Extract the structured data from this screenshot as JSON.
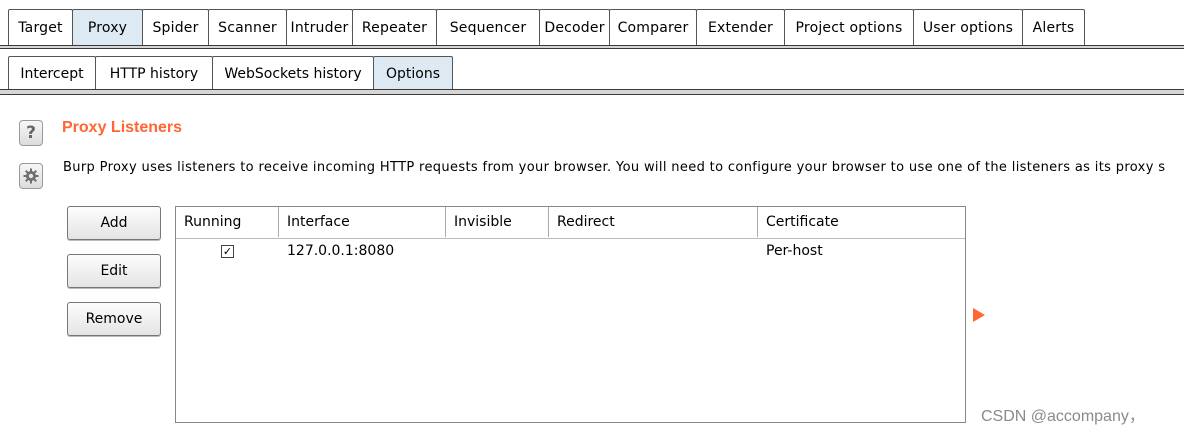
{
  "main_tabs": [
    "Target",
    "Proxy",
    "Spider",
    "Scanner",
    "Intruder",
    "Repeater",
    "Sequencer",
    "Decoder",
    "Comparer",
    "Extender",
    "Project options",
    "User options",
    "Alerts"
  ],
  "main_active": "Proxy",
  "sub_tabs": [
    "Intercept",
    "HTTP history",
    "WebSockets history",
    "Options"
  ],
  "sub_active": "Options",
  "section": {
    "help_icon": "question-icon",
    "settings_icon": "gear-icon",
    "title": "Proxy Listeners",
    "description": "Burp Proxy uses listeners to receive incoming HTTP requests from your browser. You will need to configure your browser to use one of the listeners as its proxy s"
  },
  "buttons": {
    "add": "Add",
    "edit": "Edit",
    "remove": "Remove"
  },
  "table": {
    "columns": [
      "Running",
      "Interface",
      "Invisible",
      "Redirect",
      "Certificate"
    ],
    "rows": [
      {
        "running": true,
        "interface": "127.0.0.1:8080",
        "invisible": "",
        "redirect": "",
        "certificate": "Per-host"
      }
    ]
  },
  "colors": {
    "accent": "#ff6633",
    "active_tab": "#ddeaf3"
  },
  "watermark": "CSDN @accompany，"
}
